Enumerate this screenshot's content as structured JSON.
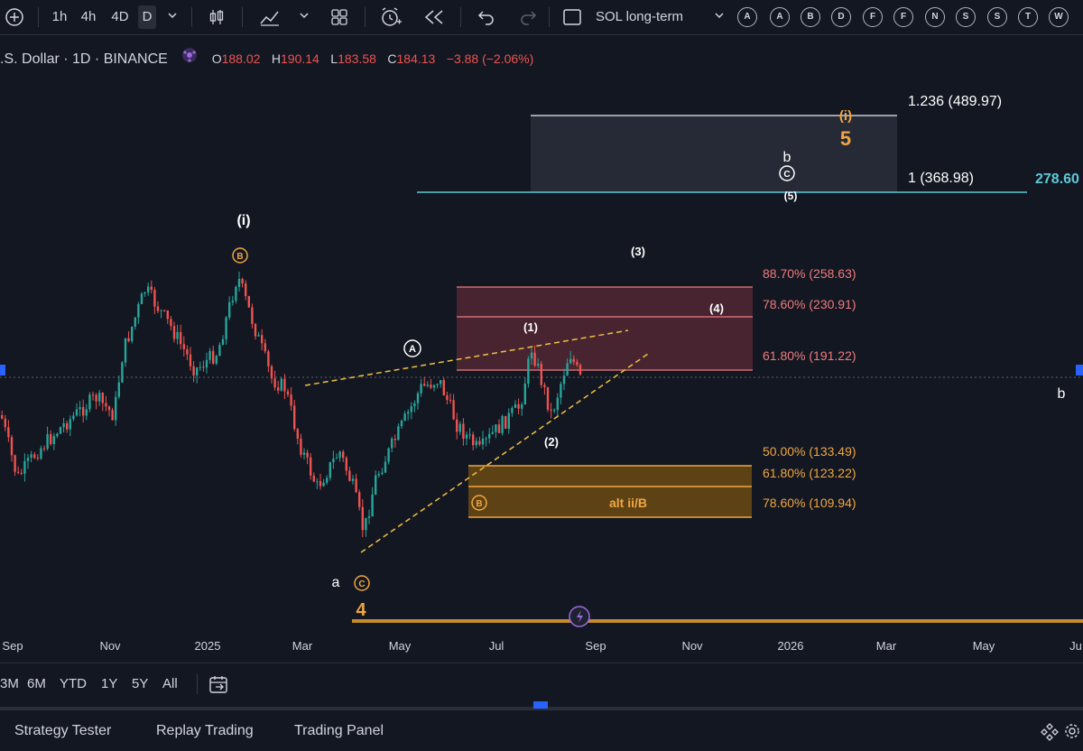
{
  "toolbar": {
    "intervals": [
      "1h",
      "4h",
      "4D",
      "D"
    ],
    "layout_name": "SOL long-term",
    "alert_buttons": [
      "A",
      "A",
      "B",
      "D",
      "F",
      "F",
      "N",
      "S",
      "S",
      "T",
      "W"
    ]
  },
  "legend": {
    "symbol": ".S. Dollar · 1D · BINANCE",
    "o_label": "O",
    "o_value": "188.02",
    "h_label": "H",
    "h_value": "190.14",
    "l_label": "L",
    "l_value": "183.58",
    "c_label": "C",
    "c_value": "184.13",
    "change": "−3.88 (−2.06%)"
  },
  "chart": {
    "price_label": "278.60",
    "right_label": "b",
    "fib_upper": [
      "1.236 (489.97)",
      "1 (368.98)"
    ],
    "fib_resistance": [
      "88.70% (258.63)",
      "78.60% (230.91)",
      "61.80% (191.22)"
    ],
    "fib_support": [
      "50.00% (133.49)",
      "61.80% (123.22)",
      "78.60% (109.94)"
    ],
    "alt_label": "alt ii/B",
    "wave_labels": {
      "i_top": "(i)",
      "b_circ": "B",
      "a_circ": "A",
      "w1": "(1)",
      "w2": "(2)",
      "w3": "(3)",
      "w4": "(4)",
      "w5": "(5)",
      "c_circ_top": "C",
      "b_top": "b",
      "i_orange": "(i)",
      "five_orange": "5",
      "b_circ_low": "B",
      "a_low": "a",
      "c_circ_low": "C",
      "four_orange": "4"
    }
  },
  "time_axis": [
    "Sep",
    "Nov",
    "2025",
    "Mar",
    "May",
    "Jul",
    "Sep",
    "Nov",
    "2026",
    "Mar",
    "May",
    "Ju"
  ],
  "range_buttons": [
    "3M",
    "6M",
    "YTD",
    "1Y",
    "5Y",
    "All"
  ],
  "bottom_tabs": [
    "Strategy Tester",
    "Replay Trading",
    "Trading Panel"
  ],
  "colors": {
    "background": "#131722",
    "up": "#26a69a",
    "down": "#ef5350",
    "fib_red": "#f07b7b",
    "fib_orange": "#f0a640",
    "teal": "#5fc9d8",
    "orange_label": "#f0a640"
  }
}
